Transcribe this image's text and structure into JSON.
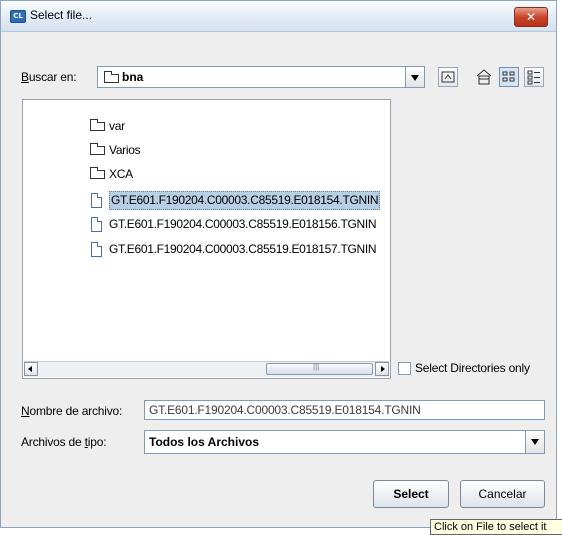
{
  "window": {
    "title": "Select file..."
  },
  "lookin": {
    "label_pre": "",
    "label_accel": "B",
    "label_post": "uscar en:",
    "value": "bna"
  },
  "toolbar": {
    "icons": [
      "up-folder-icon",
      "home-icon",
      "list-view-icon",
      "details-view-icon"
    ]
  },
  "files": [
    {
      "name": "var",
      "type": "folder"
    },
    {
      "name": "Varios",
      "type": "folder"
    },
    {
      "name": "XCA",
      "type": "folder"
    },
    {
      "name": "GT.E601.F190204.C00003.C85519.E018154.TGNIN",
      "type": "file",
      "selected": true
    },
    {
      "name": "GT.E601.F190204.C00003.C85519.E018156.TGNIN",
      "type": "file"
    },
    {
      "name": "GT.E601.F190204.C00003.C85519.E018157.TGNIN",
      "type": "file"
    }
  ],
  "select_dirs": {
    "label": "Select Directories only",
    "checked": false
  },
  "filename": {
    "label_accel": "N",
    "label_post": "ombre de archivo:",
    "value": "GT.E601.F190204.C00003.C85519.E018154.TGNIN"
  },
  "filetype": {
    "label_pre": "Archivos de ",
    "label_accel": "t",
    "label_post": "ipo:",
    "value": "Todos los Archivos"
  },
  "buttons": {
    "select": "Select",
    "cancel": "Cancelar"
  },
  "tooltip": "Click on File to select it"
}
